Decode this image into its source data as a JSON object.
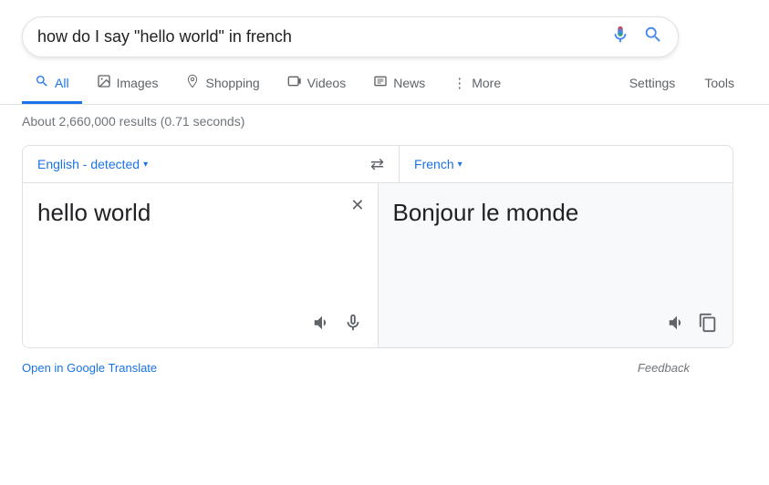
{
  "search": {
    "query": "how do I say \"hello world\" in french",
    "placeholder": "Search"
  },
  "nav": {
    "tabs": [
      {
        "label": "All",
        "icon": "🔍",
        "active": true
      },
      {
        "label": "Images",
        "icon": "🖼",
        "active": false
      },
      {
        "label": "Shopping",
        "icon": "◇",
        "active": false
      },
      {
        "label": "Videos",
        "icon": "▶",
        "active": false
      },
      {
        "label": "News",
        "icon": "☰",
        "active": false
      },
      {
        "label": "More",
        "icon": "⋮",
        "active": false
      }
    ],
    "settings_label": "Settings",
    "tools_label": "Tools"
  },
  "results": {
    "summary": "About 2,660,000 results (0.71 seconds)"
  },
  "translate": {
    "source_lang": "English - detected",
    "target_lang": "French",
    "source_text": "hello world",
    "target_text": "Bonjour le monde",
    "footer_link": "Open in Google Translate",
    "feedback_label": "Feedback"
  }
}
